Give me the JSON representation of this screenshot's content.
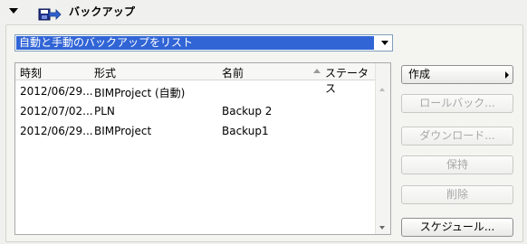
{
  "section": {
    "title": "バックアップ"
  },
  "filter": {
    "selected": "自動と手動のバックアップをリスト"
  },
  "table": {
    "columns": [
      "時刻",
      "形式",
      "名前",
      "ステータス"
    ],
    "rows": [
      {
        "time": "2012/06/29...",
        "format": "BIMProject (自動)",
        "name": ""
      },
      {
        "time": "2012/07/02...",
        "format": "PLN",
        "name": "Backup 2"
      },
      {
        "time": "2012/06/29...",
        "format": "BIMProject",
        "name": "Backup1"
      }
    ]
  },
  "buttons": {
    "create": "作成",
    "rollback": "ロールバック...",
    "download": "ダウンロード...",
    "keep": "保持",
    "delete": "削除",
    "schedule": "スケジュール..."
  }
}
